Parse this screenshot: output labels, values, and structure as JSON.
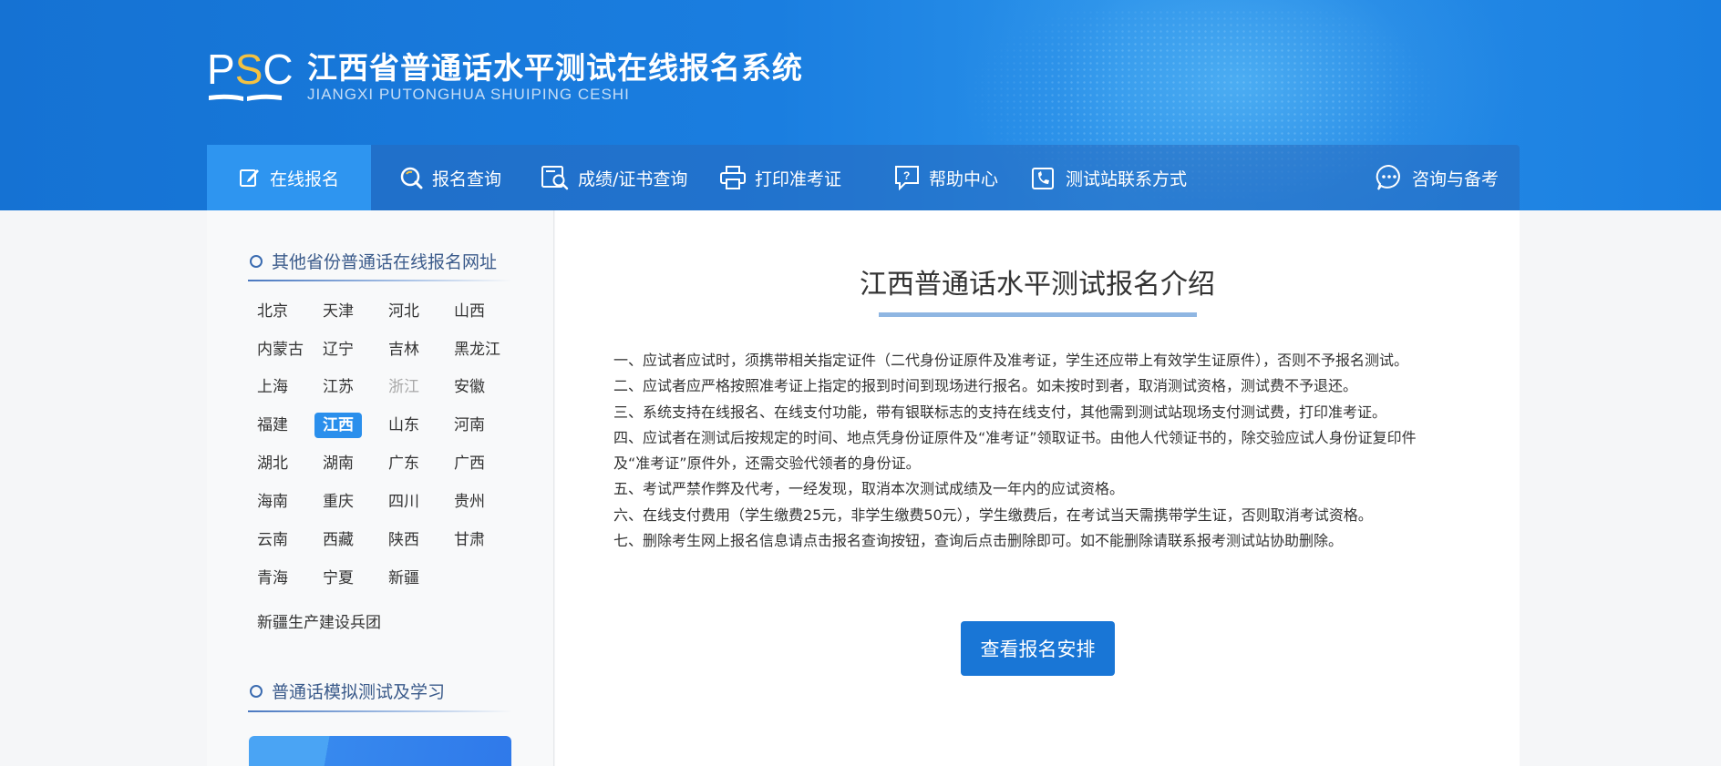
{
  "header": {
    "logo_letters_left": "P",
    "logo_letters_mid": "S",
    "logo_letters_right": "C",
    "title": "江西省普通话水平测试在线报名系统",
    "subtitle": "JIANGXI PUTONGHUA SHUIPING CESHI"
  },
  "nav": {
    "items": [
      {
        "label": "在线报名",
        "icon": "edit-icon",
        "active": true
      },
      {
        "label": "报名查询",
        "icon": "search-icon"
      },
      {
        "label": "成绩/证书查询",
        "icon": "certificate-search-icon"
      },
      {
        "label": "打印准考证",
        "icon": "printer-icon"
      },
      {
        "label": "帮助中心",
        "icon": "help-icon"
      },
      {
        "label": "测试站联系方式",
        "icon": "phone-icon"
      },
      {
        "label": "咨询与备考",
        "icon": "chat-icon"
      }
    ]
  },
  "sidebar": {
    "section1_title": "其他省份普通话在线报名网址",
    "provinces": [
      [
        "北京",
        "天津",
        "河北",
        "山西"
      ],
      [
        "内蒙古",
        "辽宁",
        "吉林",
        "黑龙江"
      ],
      [
        "上海",
        "江苏",
        "浙江",
        "安徽"
      ],
      [
        "福建",
        "江西",
        "山东",
        "河南"
      ],
      [
        "湖北",
        "湖南",
        "广东",
        "广西"
      ],
      [
        "海南",
        "重庆",
        "四川",
        "贵州"
      ],
      [
        "云南",
        "西藏",
        "陕西",
        "甘肃"
      ],
      [
        "青海",
        "宁夏",
        "新疆"
      ]
    ],
    "extra_province": "新疆生产建设兵团",
    "selected": "江西",
    "muted": "浙江",
    "section2_title": "普通话模拟测试及学习"
  },
  "content": {
    "title": "江西普通话水平测试报名介绍",
    "rules": [
      "一、应试者应试时，须携带相关指定证件（二代身份证原件及准考证，学生还应带上有效学生证原件），否则不予报名测试。",
      "二、应试者应严格按照准考证上指定的报到时间到现场进行报名。如未按时到者，取消测试资格，测试费不予退还。",
      "三、系统支持在线报名、在线支付功能，带有银联标志的支持在线支付，其他需到测试站现场支付测试费，打印准考证。",
      "四、应试者在测试后按规定的时间、地点凭身份证原件及“准考证”领取证书。由他人代领证书的，除交验应试人身份证复印件",
      "及“准考证”原件外，还需交验代领者的身份证。",
      "五、考试严禁作弊及代考，一经发现，取消本次测试成绩及一年内的应试资格。",
      "六、在线支付费用（学生缴费25元，非学生缴费50元），学生缴费后，在考试当天需携带学生证，否则取消考试资格。",
      "七、删除考生网上报名信息请点击报名查询按钮，查询后点击删除即可。如不能删除请联系报考测试站协助删除。"
    ],
    "button_label": "查看报名安排"
  },
  "colors": {
    "header_blue": "#1a7ee0",
    "nav_active": "#2e95f0",
    "button_blue": "#1976d6",
    "logo_accent": "#f3c142"
  }
}
